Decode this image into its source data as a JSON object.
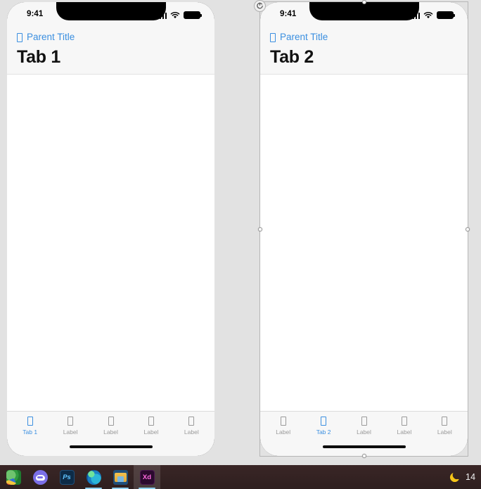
{
  "canvas": {
    "background_color": "#e2e2e2",
    "selected_artboard": "tab-2"
  },
  "artboards": [
    {
      "id": "tab-1",
      "selected": false,
      "status_bar": {
        "time": "9:41",
        "cellular_icon": "cellular-signal-icon",
        "wifi_icon": "wifi-icon",
        "battery_icon": "battery-icon"
      },
      "nav": {
        "back_icon": "back-chevron-icon",
        "back_label": "Parent Title",
        "back_color": "#3b8fe0",
        "title": "Tab 1"
      },
      "tabbar": {
        "active_index": 0,
        "active_color": "#3b8fe0",
        "inactive_color": "#9a9a9a",
        "items": [
          {
            "icon": "tab-icon",
            "label": "Tab 1"
          },
          {
            "icon": "tab-icon",
            "label": "Label"
          },
          {
            "icon": "tab-icon",
            "label": "Label"
          },
          {
            "icon": "tab-icon",
            "label": "Label"
          },
          {
            "icon": "tab-icon",
            "label": "Label"
          }
        ]
      },
      "home_indicator": "home-indicator"
    },
    {
      "id": "tab-2",
      "selected": true,
      "status_bar": {
        "time": "9:41",
        "cellular_icon": "cellular-signal-icon",
        "wifi_icon": "wifi-icon",
        "battery_icon": "battery-icon"
      },
      "nav": {
        "back_icon": "back-chevron-icon",
        "back_label": "Parent Title",
        "back_color": "#3b8fe0",
        "title": "Tab 2"
      },
      "tabbar": {
        "active_index": 1,
        "active_color": "#3b8fe0",
        "inactive_color": "#9a9a9a",
        "items": [
          {
            "icon": "tab-icon",
            "label": "Label"
          },
          {
            "icon": "tab-icon",
            "label": "Tab 2"
          },
          {
            "icon": "tab-icon",
            "label": "Label"
          },
          {
            "icon": "tab-icon",
            "label": "Label"
          },
          {
            "icon": "tab-icon",
            "label": "Label"
          }
        ]
      },
      "home_indicator": "home-indicator"
    }
  ],
  "selection": {
    "rotate_handle_icon": "rotate-handle-icon",
    "handles": [
      "top-middle",
      "middle-right",
      "middle-left",
      "bottom-middle"
    ],
    "border_color": "#b6b6b6"
  },
  "taskbar": {
    "background_color": "#322121",
    "apps": [
      {
        "icon": "paint-app-icon",
        "name": "paint",
        "running": false,
        "active": false
      },
      {
        "icon": "discord-icon",
        "name": "discord",
        "running": false,
        "active": false
      },
      {
        "icon": "photoshop-icon",
        "name": "Ps",
        "running": false,
        "active": false
      },
      {
        "icon": "edge-icon",
        "name": "edge",
        "running": true,
        "active": false
      },
      {
        "icon": "file-explorer-icon",
        "name": "explorer",
        "running": true,
        "active": false
      },
      {
        "icon": "adobe-xd-icon",
        "name": "Xd",
        "running": true,
        "active": true
      }
    ],
    "tray": {
      "moon_icon": "moon-night-light-icon",
      "clock": "14"
    }
  }
}
